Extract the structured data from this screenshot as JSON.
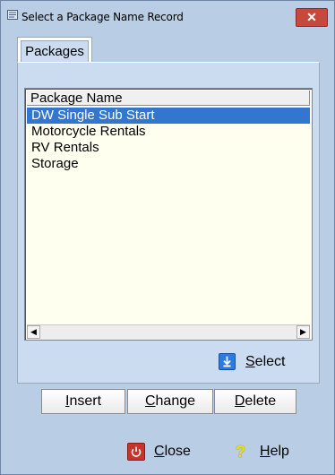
{
  "window": {
    "title": "Select a Package Name Record",
    "close_label": "✕"
  },
  "tabs": [
    {
      "label": "Packages"
    }
  ],
  "list": {
    "header": "Package Name",
    "rows": [
      "DW Single Sub Start",
      "Motorcycle Rentals",
      "RV Rentals",
      "Storage"
    ],
    "selected_index": 0
  },
  "select_button": {
    "label_u": "S",
    "label_rest": "elect"
  },
  "actions": {
    "insert": {
      "u": "I",
      "rest": "nsert"
    },
    "change": {
      "u": "C",
      "rest": "hange"
    },
    "delete": {
      "u": "D",
      "rest": "elete"
    }
  },
  "footer": {
    "close": {
      "u": "C",
      "rest": "lose"
    },
    "help": {
      "u": "H",
      "rest": "elp"
    }
  },
  "icons": {
    "app": "form-icon",
    "select": "select-arrow-icon",
    "close": "power-icon",
    "help": "question-icon"
  },
  "colors": {
    "window_bg": "#b9cde5",
    "selection": "#3276d0",
    "close_button": "#c7493d",
    "list_bg": "#fffff0"
  }
}
